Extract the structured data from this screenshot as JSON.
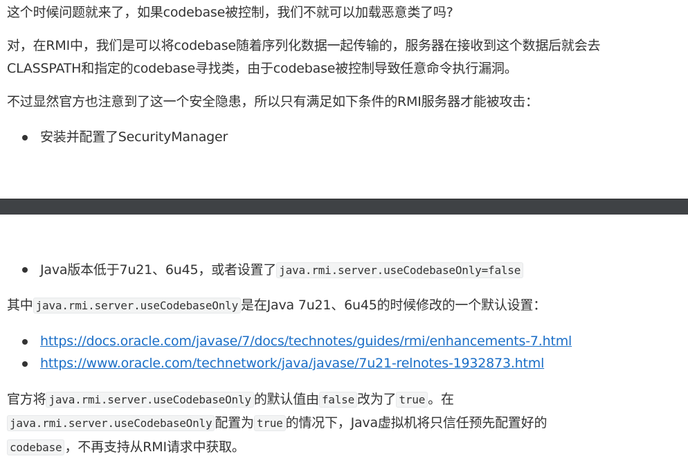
{
  "block1": {
    "p1": "这个时候问题就来了，如果codebase被控制，我们不就可以加载恶意类了吗?",
    "p2_line1": "对，在RMI中，我们是可以将codebase随着序列化数据一起传输的，服务器在接收到这个数据后就会去",
    "p2_line2": "CLASSPATH和指定的codebase寻找类，由于codebase被控制导致任意命令执行漏洞。",
    "p3": "不过显然官方也注意到了这一个安全隐患，所以只有满足如下条件的RMI服务器才能被攻击：",
    "item1": "安装并配置了SecurityManager"
  },
  "block2": {
    "item2_text": "Java版本低于7u21、6u45，或者设置了",
    "item2_code": "java.rmi.server.useCodebaseOnly=false",
    "p4_pre": "其中",
    "p4_code": "java.rmi.server.useCodebaseOnly",
    "p4_post": "是在Java 7u21、6u45的时候修改的一个默认设置：",
    "links": [
      "https://docs.oracle.com/javase/7/docs/technotes/guides/rmi/enhancements-7.html",
      "https://www.oracle.com/technetwork/java/javase/7u21-relnotes-1932873.html"
    ],
    "p5_l1_a": "官方将",
    "p5_l1_code1": "java.rmi.server.useCodebaseOnly",
    "p5_l1_b": "的默认值由",
    "p5_l1_code2": "false",
    "p5_l1_c": "改为了",
    "p5_l1_code3": "true",
    "p5_l1_d": "。在",
    "p5_l2_code1": "java.rmi.server.useCodebaseOnly",
    "p5_l2_a": "配置为",
    "p5_l2_code2": "true",
    "p5_l2_b": "的情况下，Java虚拟机将只信任预先配置好的",
    "p5_l3_code": "codebase",
    "p5_l3_a": "，不再支持从RMI请求中获取。"
  }
}
